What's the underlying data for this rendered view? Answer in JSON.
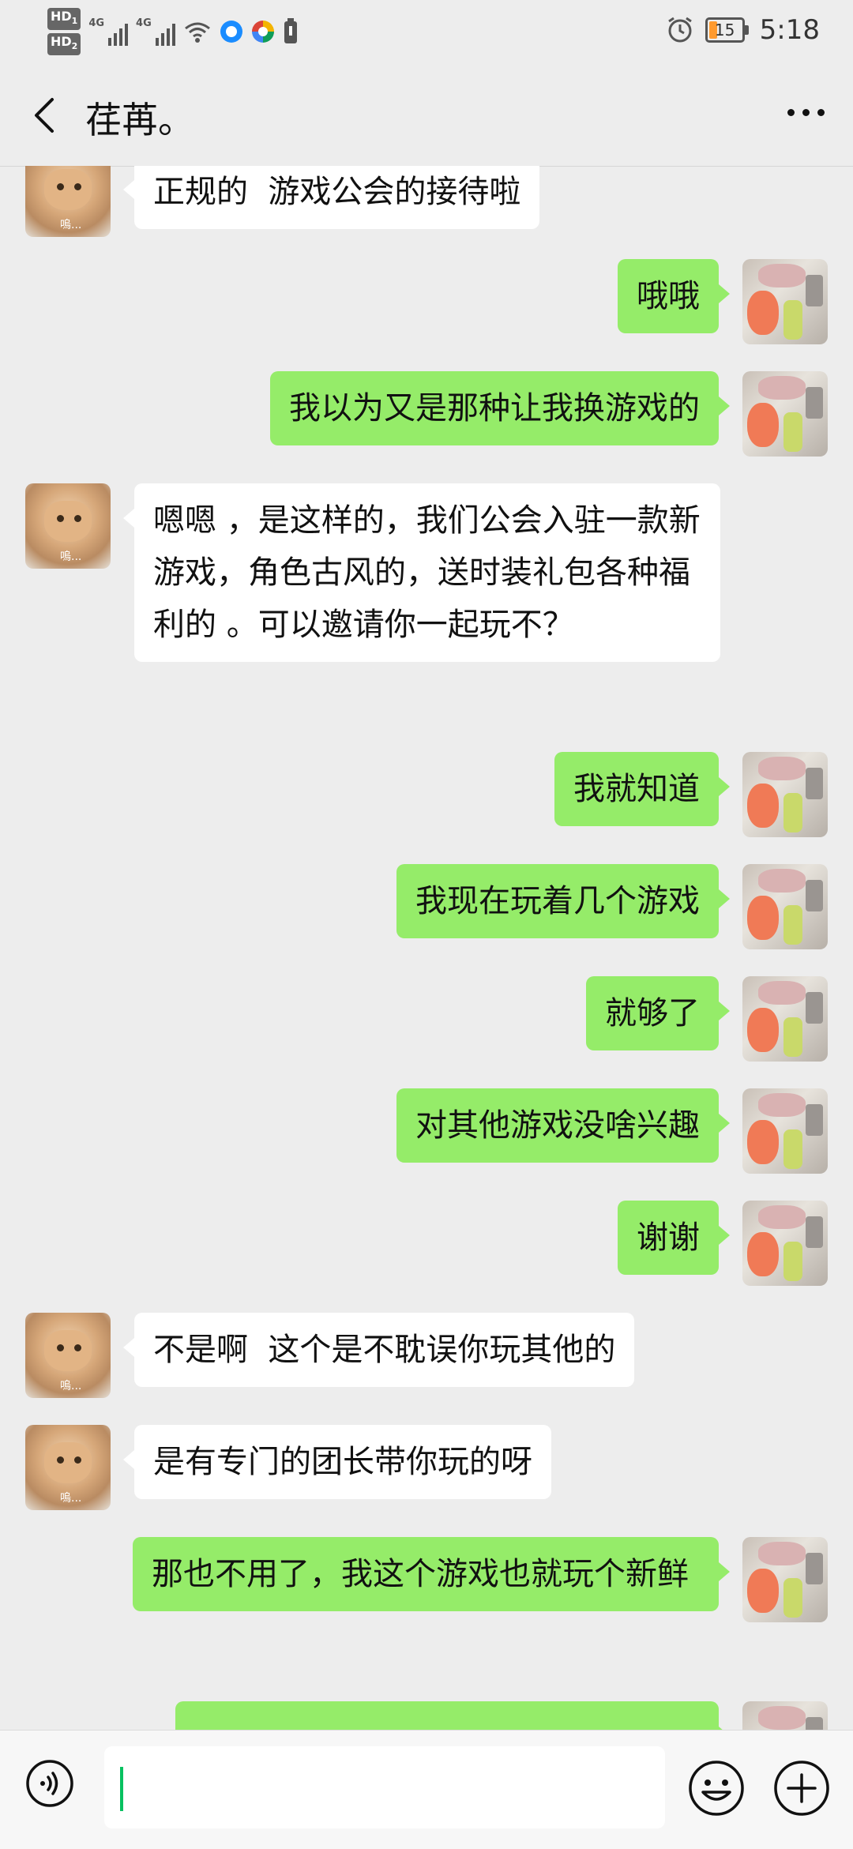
{
  "status_bar": {
    "hd1": "HD",
    "hd1_sub": "1",
    "hd2": "HD",
    "hd2_sub": "2",
    "signal1_tag": "4G",
    "signal2_tag": "4G",
    "battery_level": "15",
    "time": "5:18",
    "icons": [
      "signal-icon",
      "signal-icon",
      "wifi-icon",
      "app-icon",
      "app-icon",
      "battery-saver-icon",
      "alarm-icon",
      "battery-icon"
    ]
  },
  "header": {
    "title": "荏苒。",
    "icons": [
      "back-icon",
      "more-icon"
    ]
  },
  "colors": {
    "background": "#ededed",
    "outgoing_bubble": "#95ec69",
    "incoming_bubble": "#ffffff",
    "accent": "#07c160",
    "battery_fill": "#ff9a2e"
  },
  "avatars": {
    "contact_caption": "嗚..."
  },
  "messages": [
    {
      "side": "left",
      "text": "正规的  游戏公会的接待啦"
    },
    {
      "side": "right",
      "text": "哦哦"
    },
    {
      "side": "right",
      "text": "我以为又是那种让我换游戏的"
    },
    {
      "side": "left",
      "text": "嗯嗯 ，是这样的，我们公会入驻一款新游戏，角色古风的，送时装礼包各种福利的 。可以邀请你一起玩不？"
    },
    {
      "side": "right",
      "text": "我就知道"
    },
    {
      "side": "right",
      "text": "我现在玩着几个游戏"
    },
    {
      "side": "right",
      "text": "就够了"
    },
    {
      "side": "right",
      "text": "对其他游戏没啥兴趣"
    },
    {
      "side": "right",
      "text": "谢谢"
    },
    {
      "side": "left",
      "text": "不是啊  这个是不耽误你玩其他的"
    },
    {
      "side": "left",
      "text": "是有专门的团长带你玩的呀"
    },
    {
      "side": "right",
      "text": "那也不用了，我这个游戏也就玩个新鲜"
    },
    {
      "side": "right",
      "text": ""
    }
  ],
  "input_bar": {
    "value": "",
    "icons": [
      "voice-icon",
      "emoji-icon",
      "plus-icon"
    ]
  }
}
